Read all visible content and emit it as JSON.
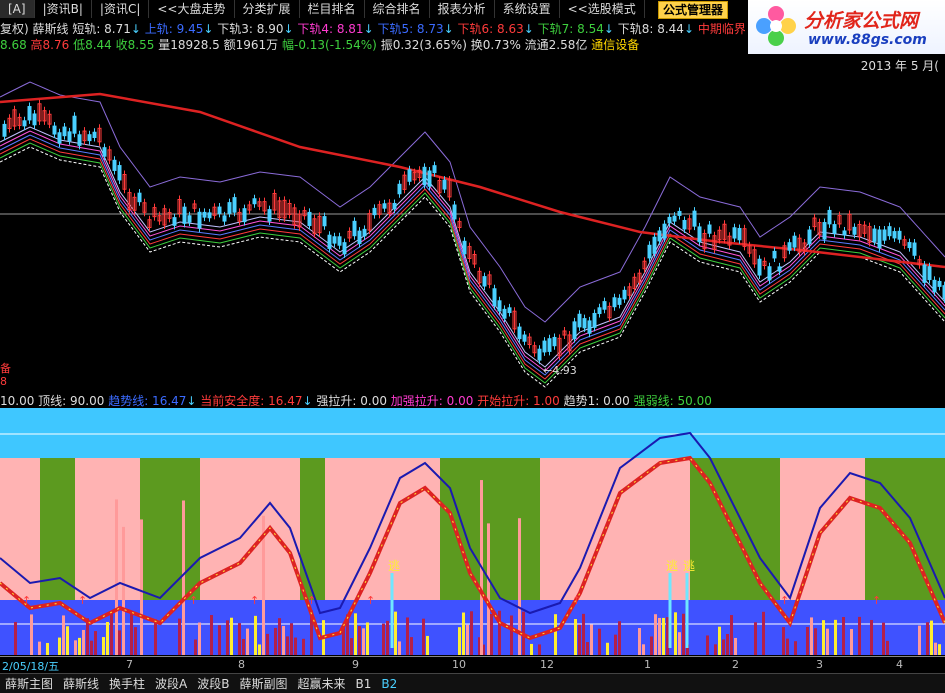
{
  "menubar": [
    "[A]",
    "|资讯B|",
    "|资讯C|",
    "<<大盘走势",
    "分类扩展",
    "栏目排名",
    "综合排名",
    "报表分析",
    "系统设置",
    "<<选股模式"
  ],
  "formula_button": "公式管理器",
  "logo": {
    "line1": "分析家公式网",
    "line2": "www.88gs.com",
    "icon": "flower-icon"
  },
  "indicator_row": [
    {
      "t": "复权) 薛斯线",
      "c": "w"
    },
    {
      "t": "  短轨: 8.71",
      "c": "w"
    },
    {
      "t": "↓",
      "c": "c"
    },
    {
      "t": "  上轨: 9.45",
      "c": "b"
    },
    {
      "t": "↓",
      "c": "c"
    },
    {
      "t": "  下轨3: 8.90",
      "c": "w"
    },
    {
      "t": "↓",
      "c": "c"
    },
    {
      "t": "  下轨4: 8.81",
      "c": "m"
    },
    {
      "t": "↓",
      "c": "c"
    },
    {
      "t": "  下轨5: 8.73",
      "c": "b"
    },
    {
      "t": "↓",
      "c": "c"
    },
    {
      "t": "  下轨6: 8.63",
      "c": "r"
    },
    {
      "t": "↓",
      "c": "c"
    },
    {
      "t": "  下轨7: 8.54",
      "c": "g"
    },
    {
      "t": "↓",
      "c": "c"
    },
    {
      "t": "  下轨8: 8.44",
      "c": "w"
    },
    {
      "t": "↓",
      "c": "c"
    },
    {
      "t": "  中期临界线",
      "c": "r"
    }
  ],
  "quote_row": [
    {
      "t": "8.68 ",
      "c": "g"
    },
    {
      "t": "高8.76 ",
      "c": "r"
    },
    {
      "t": "低8.44 ",
      "c": "g"
    },
    {
      "t": "收8.55 ",
      "c": "g"
    },
    {
      "t": "量18928.5 ",
      "c": "w"
    },
    {
      "t": "额1961万 ",
      "c": "w"
    },
    {
      "t": "幅-0.13(-1.54%) ",
      "c": "g"
    },
    {
      "t": "振0.32(3.65%) ",
      "c": "w"
    },
    {
      "t": "换0.73% ",
      "c": "w"
    },
    {
      "t": "流通2.58亿 ",
      "c": "w"
    },
    {
      "t": "通信设备",
      "c": "y"
    }
  ],
  "date_top": "2013 年 5 月(",
  "main_labels": {
    "low_price": "←4.93",
    "left_mark1": "备",
    "left_mark2": "8"
  },
  "sub_legend": [
    {
      "t": "10.00  ",
      "c": "w"
    },
    {
      "t": "顶线: 90.00  ",
      "c": "w"
    },
    {
      "t": "趋势线: 16.47",
      "c": "b"
    },
    {
      "t": "↓  ",
      "c": "c"
    },
    {
      "t": "当前安全度: 16.47",
      "c": "r"
    },
    {
      "t": "↓",
      "c": "c"
    },
    {
      "t": "                     强拉升: 0.00  ",
      "c": "w"
    },
    {
      "t": "加强拉升: 0.00  ",
      "c": "m"
    },
    {
      "t": "开始拉升: 1.00  ",
      "c": "r"
    },
    {
      "t": "趋势1: 0.00",
      "c": "w"
    },
    {
      "t": "                                   强弱线: 50.00",
      "c": "g"
    }
  ],
  "sub_labels": {
    "escape1": "逃",
    "escape2": "逃",
    "escape3": "逃"
  },
  "axis_ticks": [
    "2/05/18/五",
    "7",
    "8",
    "9",
    "10",
    "12",
    "1",
    "2",
    "3",
    "4"
  ],
  "tabs": [
    "薛斯主图",
    "薛斯线",
    "换手柱",
    "波段A",
    "波段B",
    "薛斯副图",
    "超赢未来",
    "B1",
    "B2"
  ],
  "colors": {
    "pink": "#ffb3b3",
    "green": "#5c9a1f",
    "cyan": "#3fc7ff",
    "blue": "#3f52ff",
    "red": "#dd2222",
    "yellow": "#ffee33"
  }
}
